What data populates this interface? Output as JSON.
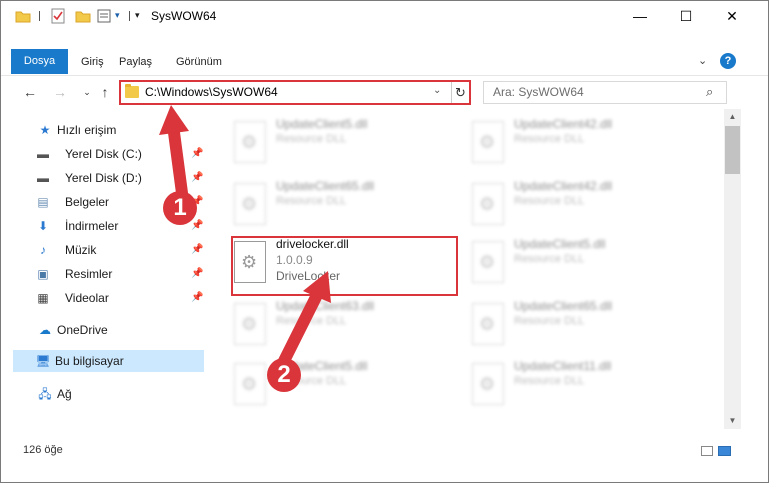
{
  "window": {
    "title": "SysWOW64",
    "controls": {
      "minimize": "—",
      "maximize": "☐",
      "close": "✕"
    }
  },
  "ribbon": {
    "tabs": [
      "Dosya",
      "Giriş",
      "Paylaş",
      "Görünüm"
    ],
    "help": "?"
  },
  "navigation": {
    "address": "C:\\Windows\\SysWOW64",
    "search_placeholder": "Ara: SysWOW64"
  },
  "sidebar": {
    "quick_access": "Hızlı erişim",
    "items": [
      {
        "label": "Yerel Disk (C:)",
        "icon": "drive-icon",
        "pinned": true
      },
      {
        "label": "Yerel Disk (D:)",
        "icon": "drive-icon",
        "pinned": true
      },
      {
        "label": "Belgeler",
        "icon": "documents-icon",
        "pinned": true
      },
      {
        "label": "İndirmeler",
        "icon": "downloads-icon",
        "pinned": true
      },
      {
        "label": "Müzik",
        "icon": "music-icon",
        "pinned": true
      },
      {
        "label": "Resimler",
        "icon": "pictures-icon",
        "pinned": true
      },
      {
        "label": "Videolar",
        "icon": "videos-icon",
        "pinned": true
      }
    ],
    "onedrive": "OneDrive",
    "this_pc": "Bu bilgisayar",
    "network": "Ağ"
  },
  "files": {
    "background": [
      {
        "name": "UpdateClient5.dll",
        "desc": "Resource DLL"
      },
      {
        "name": "UpdateClient42.dll",
        "desc": "Resource DLL"
      },
      {
        "name": "UpdateClient65.dll",
        "desc": "Resource DLL"
      },
      {
        "name": "UpdateClient42.dll",
        "desc": "Resource DLL"
      },
      {
        "name": "UpdateClient5.dll",
        "desc": "Resource DLL"
      },
      {
        "name": "UpdateClient63.dll",
        "desc": "Resource DLL"
      },
      {
        "name": "UpdateClient65.dll",
        "desc": "Resource DLL"
      },
      {
        "name": "UpdateClient5.dll",
        "desc": "Resource DLL"
      },
      {
        "name": "UpdateClient11.dll",
        "desc": "Resource DLL"
      }
    ],
    "selected": {
      "name": "drivelocker.dll",
      "version": "1.0.0.9",
      "desc": "DriveLocker"
    }
  },
  "status": {
    "item_count": "126 öğe"
  },
  "callouts": {
    "one": "1",
    "two": "2"
  },
  "colors": {
    "accent": "#1979ca",
    "highlight": "#d9353a",
    "selected_nav": "#cce8ff"
  }
}
